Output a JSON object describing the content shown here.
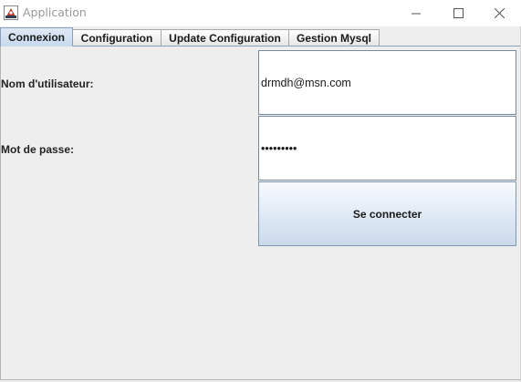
{
  "window": {
    "title": "Application",
    "icon": "java-app-icon",
    "controls": [
      "minimize-icon",
      "maximize-icon",
      "close-icon"
    ]
  },
  "tabs": [
    {
      "label": "Connexion",
      "active": true
    },
    {
      "label": "Configuration",
      "active": false
    },
    {
      "label": "Update Configuration",
      "active": false
    },
    {
      "label": "Gestion Mysql",
      "active": false
    }
  ],
  "form": {
    "username_label": "Nom d'utilisateur:",
    "username_value": "drmdh@msn.com",
    "password_label": "Mot de passe:",
    "password_value": "•••••••••",
    "submit_label": "Se connecter"
  },
  "colors": {
    "active_tab": "#c7d9ee",
    "window_bg": "#eeeeee",
    "button_gradient_bottom": "#cad9ea"
  }
}
